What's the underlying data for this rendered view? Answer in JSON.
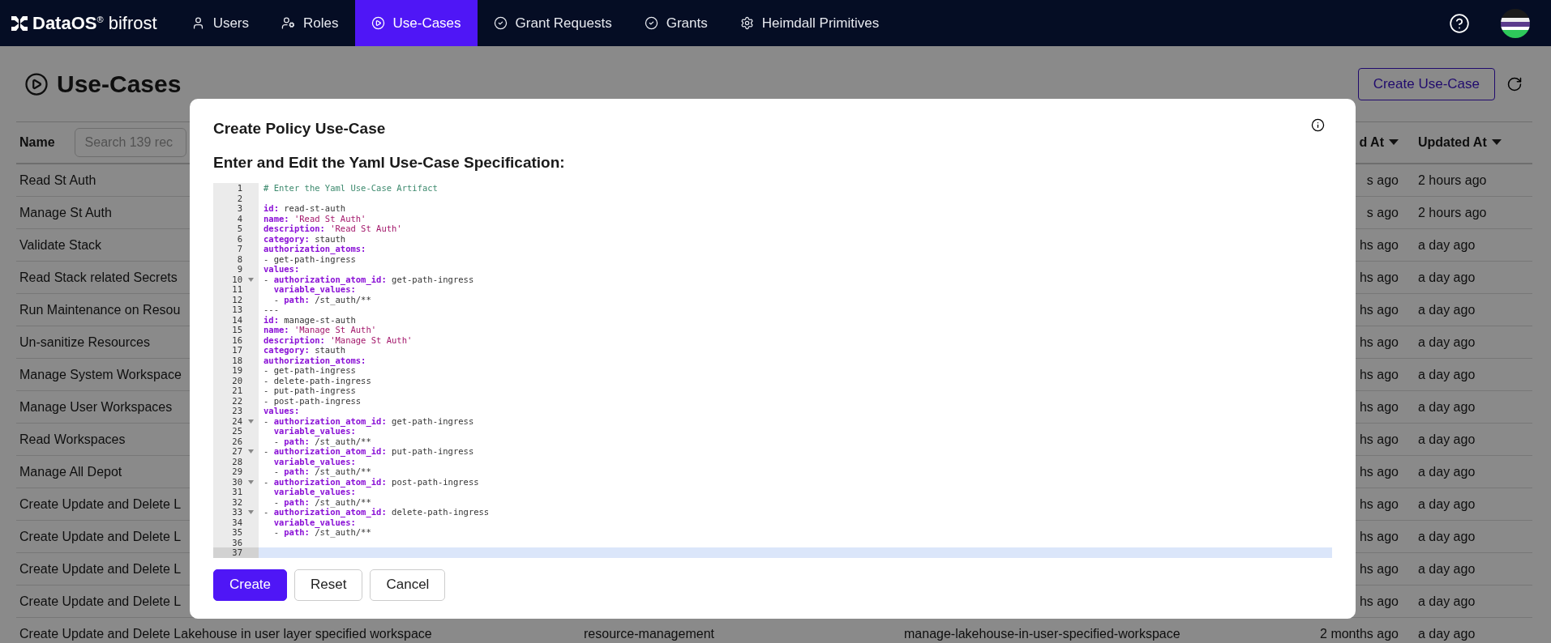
{
  "nav": {
    "logo": "**DataOS**$^{®}$ bifrost",
    "items": [
      {
        "label": "Users",
        "selected": false
      },
      {
        "label": "Roles",
        "selected": false
      },
      {
        "label": "Use-Cases",
        "selected": true
      },
      {
        "label": "Grant Requests",
        "selected": false
      },
      {
        "label": "Grants",
        "selected": false
      },
      {
        "label": "Heimdall Primitives",
        "selected": false
      }
    ]
  },
  "page": {
    "title": "Use-Cases",
    "create_button": "Create Use-Case"
  },
  "table": {
    "columns": [
      {
        "label": "Name",
        "search_placeholder": "Search 139 rec"
      },
      {
        "label": "d At",
        "sortable": true
      },
      {
        "label": "Updated At",
        "sortable": true
      }
    ],
    "rows": [
      {
        "name": "Read St Auth",
        "created": "s ago",
        "updated": "2 hours ago"
      },
      {
        "name": "Manage St Auth",
        "created": "s ago",
        "updated": "2 hours ago"
      },
      {
        "name": "Validate Stack",
        "created": "hs ago",
        "updated": "a day ago"
      },
      {
        "name": "Read Stack related Secrets",
        "created": "hs ago",
        "updated": "a day ago"
      },
      {
        "name": "Run Maintenance on Resou",
        "created": "hs ago",
        "updated": "a day ago"
      },
      {
        "name": "Un-sanitize Resources",
        "created": "hs ago",
        "updated": "a day ago"
      },
      {
        "name": "Manage System Workspace",
        "created": "hs ago",
        "updated": "a day ago"
      },
      {
        "name": "Manage User Workspaces",
        "created": "hs ago",
        "updated": "a day ago"
      },
      {
        "name": "Read Workspaces",
        "created": "hs ago",
        "updated": "a day ago"
      },
      {
        "name": "Manage All Depot",
        "created": "hs ago",
        "updated": "a day ago"
      },
      {
        "name": "Create Update and Delete L",
        "created": "hs ago",
        "updated": "a day ago"
      },
      {
        "name": "Create Update and Delete L",
        "created": "hs ago",
        "updated": "a day ago"
      },
      {
        "name": "Create Update and Delete L",
        "created": "hs ago",
        "updated": "a day ago"
      },
      {
        "name": "Create Update and Delete L",
        "created": "hs ago",
        "updated": "a day ago"
      },
      {
        "name": "Create Update and Delete Lakehouse in user layer specified workspace",
        "column_2": "resource-management",
        "column_3": "manage-lakehouse-in-user-specified-workspace",
        "created": "2 months ago",
        "updated": "a day ago"
      }
    ]
  },
  "modal": {
    "title": "Create Policy Use-Case",
    "subtitle": "Enter and Edit the Yaml Use-Case Specification:",
    "editor": {
      "lines": [
        {
          "n": "1",
          "fold": false,
          "active": false,
          "tokens": [
            {
              "kind": "comment",
              "text": "# Enter the Yaml Use-Case Artifact"
            }
          ]
        },
        {
          "n": "2",
          "fold": false,
          "active": false
        },
        {
          "n": "3",
          "fold": false,
          "active": false,
          "tokens": [
            {
              "kind": "key",
              "text": "id:"
            },
            {
              "kind": "plain",
              "text": " read-st-auth"
            }
          ]
        },
        {
          "n": "4",
          "fold": false,
          "active": false,
          "tokens": [
            {
              "kind": "key",
              "text": "name:"
            },
            {
              "kind": "string",
              "text": " 'Read St Auth'"
            }
          ]
        },
        {
          "n": "5",
          "fold": false,
          "active": false,
          "tokens": [
            {
              "kind": "key",
              "text": "description:"
            },
            {
              "kind": "string",
              "text": " 'Read St Auth'"
            }
          ]
        },
        {
          "n": "6",
          "fold": false,
          "active": false,
          "tokens": [
            {
              "kind": "key",
              "text": "category:"
            },
            {
              "kind": "plain",
              "text": " stauth"
            }
          ]
        },
        {
          "n": "7",
          "fold": false,
          "active": false,
          "tokens": [
            {
              "kind": "key",
              "text": "authorization_atoms:"
            }
          ]
        },
        {
          "n": "8",
          "fold": false,
          "active": false,
          "tokens": [
            {
              "kind": "plain",
              "text": "- get-path-ingress"
            }
          ]
        },
        {
          "n": "9",
          "fold": false,
          "active": false,
          "tokens": [
            {
              "kind": "key",
              "text": "values:"
            }
          ]
        },
        {
          "n": "10",
          "fold": true,
          "active": false,
          "tokens": [
            {
              "kind": "plain",
              "text": "- "
            },
            {
              "kind": "key",
              "text": "authorization_atom_id:"
            },
            {
              "kind": "plain",
              "text": " get-path-ingress"
            }
          ]
        },
        {
          "n": "11",
          "fold": false,
          "active": false,
          "tokens": [
            {
              "kind": "key",
              "text": "  variable_values:"
            }
          ]
        },
        {
          "n": "12",
          "fold": false,
          "active": false,
          "tokens": [
            {
              "kind": "plain",
              "text": "  - "
            },
            {
              "kind": "key",
              "text": "path:"
            },
            {
              "kind": "plain",
              "text": " /st_auth/**"
            }
          ]
        },
        {
          "n": "13",
          "fold": false,
          "active": false,
          "tokens": [
            {
              "kind": "plain",
              "text": "---"
            }
          ]
        },
        {
          "n": "14",
          "fold": false,
          "active": false,
          "tokens": [
            {
              "kind": "key",
              "text": "id:"
            },
            {
              "kind": "plain",
              "text": " manage-st-auth"
            }
          ]
        },
        {
          "n": "15",
          "fold": false,
          "active": false,
          "tokens": [
            {
              "kind": "key",
              "text": "name:"
            },
            {
              "kind": "string",
              "text": " 'Manage St Auth'"
            }
          ]
        },
        {
          "n": "16",
          "fold": false,
          "active": false,
          "tokens": [
            {
              "kind": "key",
              "text": "description:"
            },
            {
              "kind": "string",
              "text": " 'Manage St Auth'"
            }
          ]
        },
        {
          "n": "17",
          "fold": false,
          "active": false,
          "tokens": [
            {
              "kind": "key",
              "text": "category:"
            },
            {
              "kind": "plain",
              "text": " stauth"
            }
          ]
        },
        {
          "n": "18",
          "fold": false,
          "active": false,
          "tokens": [
            {
              "kind": "key",
              "text": "authorization_atoms:"
            }
          ]
        },
        {
          "n": "19",
          "fold": false,
          "active": false,
          "tokens": [
            {
              "kind": "plain",
              "text": "- get-path-ingress"
            }
          ]
        },
        {
          "n": "20",
          "fold": false,
          "active": false,
          "tokens": [
            {
              "kind": "plain",
              "text": "- delete-path-ingress"
            }
          ]
        },
        {
          "n": "21",
          "fold": false,
          "active": false,
          "tokens": [
            {
              "kind": "plain",
              "text": "- put-path-ingress"
            }
          ]
        },
        {
          "n": "22",
          "fold": false,
          "active": false,
          "tokens": [
            {
              "kind": "plain",
              "text": "- post-path-ingress"
            }
          ]
        },
        {
          "n": "23",
          "fold": false,
          "active": false,
          "tokens": [
            {
              "kind": "key",
              "text": "values:"
            }
          ]
        },
        {
          "n": "24",
          "fold": true,
          "active": false,
          "tokens": [
            {
              "kind": "plain",
              "text": "- "
            },
            {
              "kind": "key",
              "text": "authorization_atom_id:"
            },
            {
              "kind": "plain",
              "text": " get-path-ingress"
            }
          ]
        },
        {
          "n": "25",
          "fold": false,
          "active": false,
          "tokens": [
            {
              "kind": "key",
              "text": "  variable_values:"
            }
          ]
        },
        {
          "n": "26",
          "fold": false,
          "active": false,
          "tokens": [
            {
              "kind": "plain",
              "text": "  - "
            },
            {
              "kind": "key",
              "text": "path:"
            },
            {
              "kind": "plain",
              "text": " /st_auth/**"
            }
          ]
        },
        {
          "n": "27",
          "fold": true,
          "active": false,
          "tokens": [
            {
              "kind": "plain",
              "text": "- "
            },
            {
              "kind": "key",
              "text": "authorization_atom_id:"
            },
            {
              "kind": "plain",
              "text": " put-path-ingress"
            }
          ]
        },
        {
          "n": "28",
          "fold": false,
          "active": false,
          "tokens": [
            {
              "kind": "key",
              "text": "  variable_values:"
            }
          ]
        },
        {
          "n": "29",
          "fold": false,
          "active": false,
          "tokens": [
            {
              "kind": "plain",
              "text": "  - "
            },
            {
              "kind": "key",
              "text": "path:"
            },
            {
              "kind": "plain",
              "text": " /st_auth/**"
            }
          ]
        },
        {
          "n": "30",
          "fold": true,
          "active": false,
          "tokens": [
            {
              "kind": "plain",
              "text": "- "
            },
            {
              "kind": "key",
              "text": "authorization_atom_id:"
            },
            {
              "kind": "plain",
              "text": " post-path-ingress"
            }
          ]
        },
        {
          "n": "31",
          "fold": false,
          "active": false,
          "tokens": [
            {
              "kind": "key",
              "text": "  variable_values:"
            }
          ]
        },
        {
          "n": "32",
          "fold": false,
          "active": false,
          "tokens": [
            {
              "kind": "plain",
              "text": "  - "
            },
            {
              "kind": "key",
              "text": "path:"
            },
            {
              "kind": "plain",
              "text": " /st_auth/**"
            }
          ]
        },
        {
          "n": "33",
          "fold": true,
          "active": false,
          "tokens": [
            {
              "kind": "plain",
              "text": "- "
            },
            {
              "kind": "key",
              "text": "authorization_atom_id:"
            },
            {
              "kind": "plain",
              "text": " delete-path-ingress"
            }
          ]
        },
        {
          "n": "34",
          "fold": false,
          "active": false,
          "tokens": [
            {
              "kind": "key",
              "text": "  variable_values:"
            }
          ]
        },
        {
          "n": "35",
          "fold": false,
          "active": false,
          "tokens": [
            {
              "kind": "plain",
              "text": "  - "
            },
            {
              "kind": "key",
              "text": "path:"
            },
            {
              "kind": "plain",
              "text": " /st_auth/**"
            }
          ]
        },
        {
          "n": "36",
          "fold": false,
          "active": false
        },
        {
          "n": "37",
          "fold": false,
          "active": true
        }
      ]
    },
    "buttons": [
      {
        "label": "Create",
        "kind": "primary"
      },
      {
        "label": "Reset",
        "kind": "secondary"
      },
      {
        "label": "Cancel",
        "kind": "secondary"
      }
    ]
  }
}
